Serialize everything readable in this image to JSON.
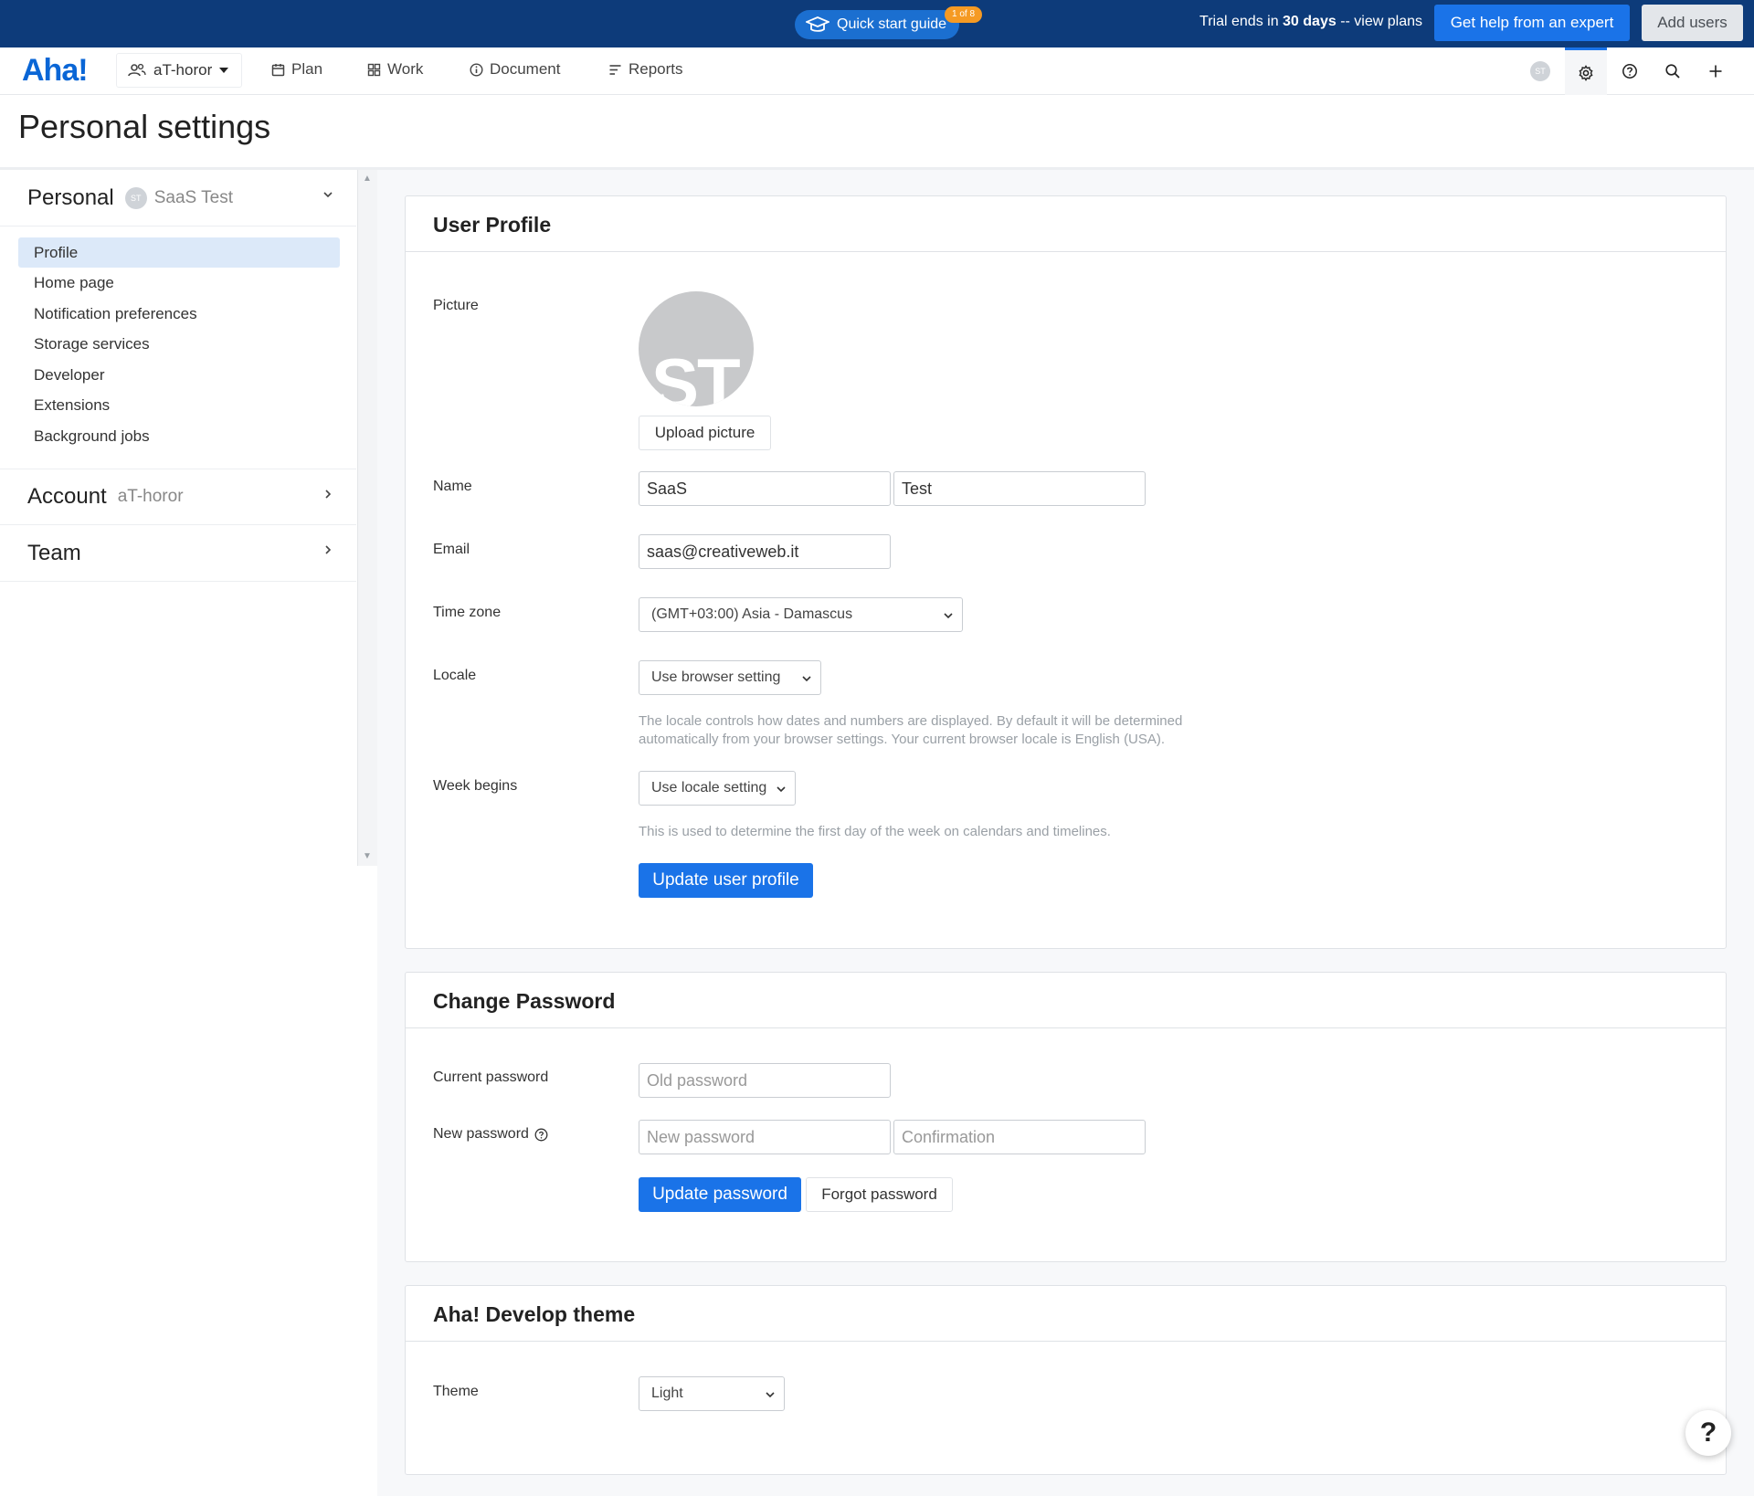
{
  "topbar": {
    "quick_start": "Quick start guide",
    "quick_start_badge": "1 of 8",
    "trial_prefix": "Trial ends in ",
    "trial_days": "30 days",
    "trial_suffix": " -- view plans",
    "expert_button": "Get help from an expert",
    "add_users_button": "Add users"
  },
  "nav": {
    "logo": "Aha!",
    "workspace": "aT-horor",
    "items": [
      {
        "label": "Plan",
        "icon": "calendar-icon"
      },
      {
        "label": "Work",
        "icon": "grid-icon"
      },
      {
        "label": "Document",
        "icon": "info-circle-icon"
      },
      {
        "label": "Reports",
        "icon": "report-icon"
      }
    ],
    "avatar_initials": "ST"
  },
  "page": {
    "title": "Personal settings"
  },
  "sidebar": {
    "personal": {
      "label": "Personal",
      "avatar_initials": "ST",
      "user": "SaaS Test"
    },
    "items": [
      {
        "label": "Profile",
        "active": true
      },
      {
        "label": "Home page"
      },
      {
        "label": "Notification preferences"
      },
      {
        "label": "Storage services"
      },
      {
        "label": "Developer"
      },
      {
        "label": "Extensions"
      },
      {
        "label": "Background jobs"
      }
    ],
    "account": {
      "label": "Account",
      "sub": "aT-horor"
    },
    "team": {
      "label": "Team"
    }
  },
  "profile": {
    "title": "User Profile",
    "picture_label": "Picture",
    "avatar_initials": "ST",
    "upload_button": "Upload picture",
    "name_label": "Name",
    "first_name": "SaaS",
    "last_name": "Test",
    "email_label": "Email",
    "email": "saas@creativeweb.it",
    "timezone_label": "Time zone",
    "timezone": "(GMT+03:00) Asia - Damascus",
    "locale_label": "Locale",
    "locale": "Use browser setting",
    "locale_help": "The locale controls how dates and numbers are displayed. By default it will be determined automatically from your browser settings. Your current browser locale is English (USA).",
    "week_label": "Week begins",
    "week": "Use locale setting",
    "week_help": "This is used to determine the first day of the week on calendars and timelines.",
    "update_button": "Update user profile"
  },
  "password": {
    "title": "Change Password",
    "current_label": "Current password",
    "current_placeholder": "Old password",
    "new_label": "New password",
    "new_placeholder": "New password",
    "confirm_placeholder": "Confirmation",
    "update_button": "Update password",
    "forgot_button": "Forgot password"
  },
  "theme": {
    "title": "Aha! Develop theme",
    "theme_label": "Theme",
    "theme_value": "Light"
  },
  "help_button": "?",
  "colors": {
    "navy": "#0d3b7a",
    "accent": "#1a73e8",
    "badge": "#f59a23"
  }
}
